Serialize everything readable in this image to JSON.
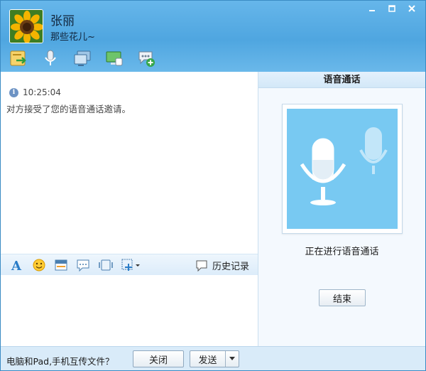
{
  "contact": {
    "name": "张丽",
    "signature": "那些花儿~"
  },
  "window_controls": [
    "minimize-icon",
    "maximize-icon",
    "close-icon"
  ],
  "toolbar": {
    "icons": [
      "file-transfer-icon",
      "voice-call-icon",
      "video-call-icon",
      "remote-desktop-icon",
      "create-group-icon"
    ]
  },
  "chat": {
    "messages": [
      {
        "time": "10:25:04",
        "text": "对方接受了您的语音通话邀请。"
      }
    ]
  },
  "input_toolbar": {
    "icons": [
      "font-icon",
      "emoji-icon",
      "screenshot-icon",
      "message-bubble-icon",
      "shake-icon",
      "image-icon"
    ],
    "history_label": "历史记录"
  },
  "voice_panel": {
    "title": "语音通话",
    "status": "正在进行语音通话",
    "end_label": "结束"
  },
  "footer": {
    "link_text": "电脑和Pad,手机互传文件？",
    "close_label": "关闭",
    "send_label": "发送"
  },
  "colors": {
    "header_blue": "#4fa6e0",
    "voice_bg": "#78c9f2",
    "footer_bg": "#d9ebf9"
  }
}
